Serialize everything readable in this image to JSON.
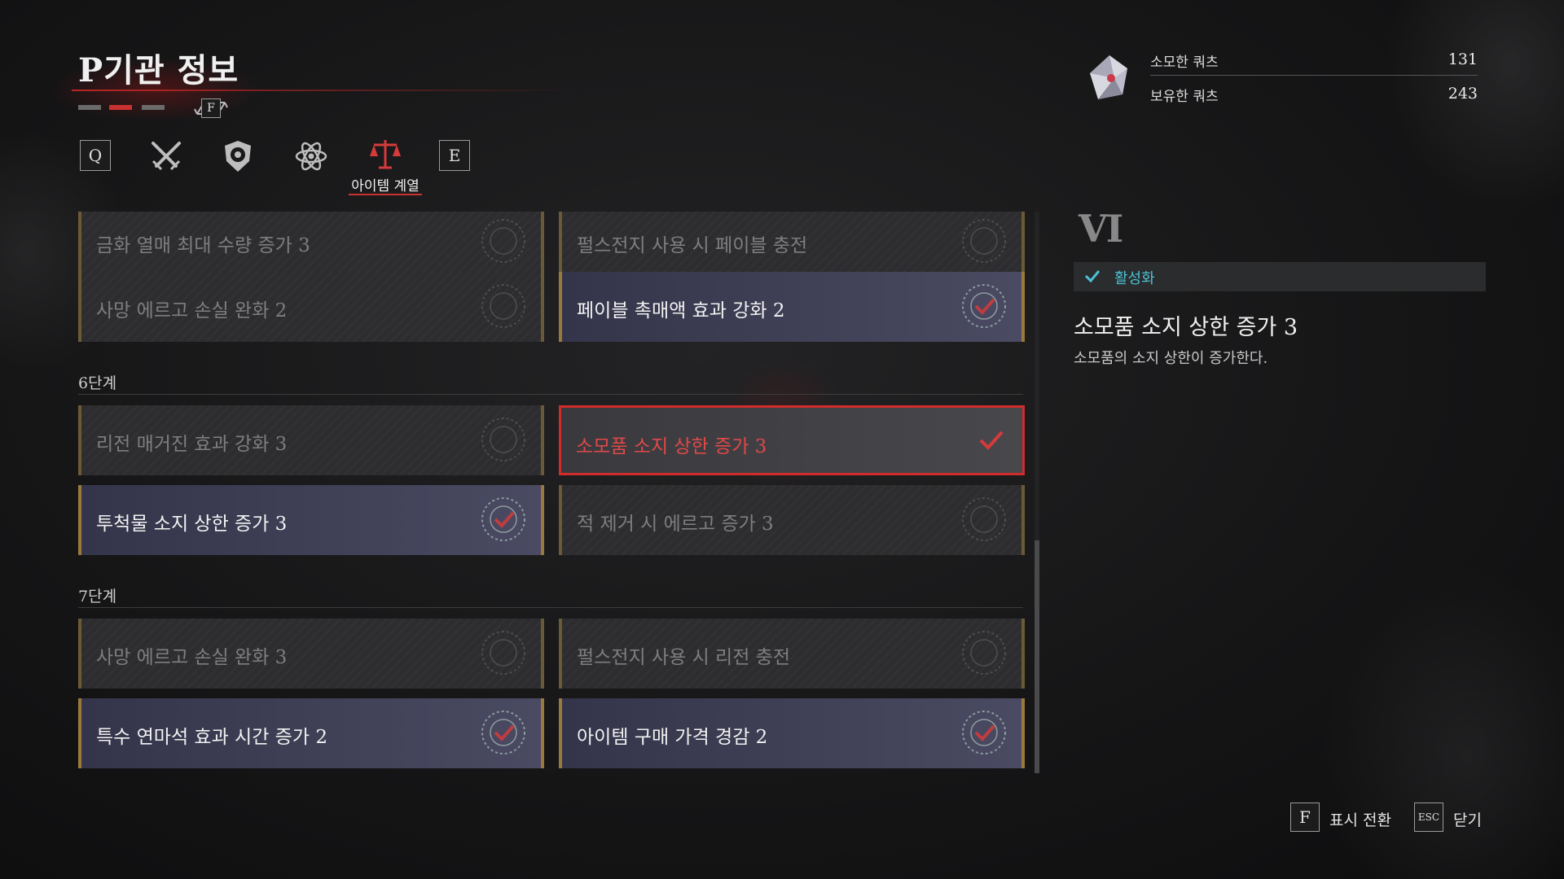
{
  "header": {
    "title": "P기관 정보",
    "switch_key": "F",
    "page_count": 3,
    "active_page_index": 1
  },
  "tabs": {
    "prev_key": "Q",
    "next_key": "E",
    "items": [
      {
        "icon": "crossed-swords-icon"
      },
      {
        "icon": "shield-emblem-icon"
      },
      {
        "icon": "atom-icon"
      },
      {
        "icon": "scales-icon",
        "label": "아이템 계열",
        "active": true
      }
    ]
  },
  "list": {
    "rows": [
      {
        "left": {
          "label": "금화 열매 최대 수량 증가 3",
          "state": "inactive"
        },
        "right": {
          "label": "펄스전지 사용 시 페이블 충전",
          "state": "inactive"
        }
      },
      {
        "left": {
          "label": "사망 에르고 손실 완화 2",
          "state": "inactive"
        },
        "right": {
          "label": "페이블 촉매액 효과 강화 2",
          "state": "active"
        }
      },
      {
        "stage": "6단계"
      },
      {
        "left": {
          "label": "리전 매거진 효과 강화 3",
          "state": "inactive"
        },
        "right": {
          "label": "소모품 소지 상한 증가 3",
          "state": "selected"
        }
      },
      {
        "left": {
          "label": "투척물 소지 상한 증가 3",
          "state": "active"
        },
        "right": {
          "label": "적 제거 시 에르고 증가 3",
          "state": "inactive"
        }
      },
      {
        "stage": "7단계"
      },
      {
        "left": {
          "label": "사망 에르고 손실 완화 3",
          "state": "inactive"
        },
        "right": {
          "label": "펄스전지 사용 시 리전 충전",
          "state": "inactive"
        }
      },
      {
        "left": {
          "label": "특수 연마석 효과 시간 증가 2",
          "state": "active"
        },
        "right": {
          "label": "아이템 구매 가격 경감 2",
          "state": "active"
        }
      }
    ],
    "stage6": "6단계",
    "stage7": "7단계",
    "r0l": "금화 열매 최대 수량 증가 3",
    "r0r": "펄스전지 사용 시 페이블 충전",
    "r1l": "사망 에르고 손실 완화 2",
    "r1r": "페이블 촉매액 효과 강화 2",
    "r2l": "리전 매거진 효과 강화 3",
    "r2r": "소모품 소지 상한 증가 3",
    "r3l": "투척물 소지 상한 증가 3",
    "r3r": "적 제거 시 에르고 증가 3",
    "r4l": "사망 에르고 손실 완화 3",
    "r4r": "펄스전지 사용 시 리전 충전",
    "r5l": "특수 연마석 효과 시간 증가 2",
    "r5r": "아이템 구매 가격 경감 2"
  },
  "resources": {
    "icon": "quartz-crystal-icon",
    "spent_label": "소모한 쿼츠",
    "spent_value": "131",
    "owned_label": "보유한 쿼츠",
    "owned_value": "243"
  },
  "detail": {
    "tier": "VI",
    "status": "활성화",
    "name": "소모품 소지 상한 증가 3",
    "description": "소모품의 소지 상한이 증가한다."
  },
  "footer": {
    "toggle_key": "F",
    "toggle_label": "표시 전환",
    "close_key": "ESC",
    "close_label": "닫기"
  },
  "colors": {
    "accent_red": "#d12c2c",
    "active_status": "#4cc1d6",
    "card_border_gold": "#9a7a3c"
  }
}
